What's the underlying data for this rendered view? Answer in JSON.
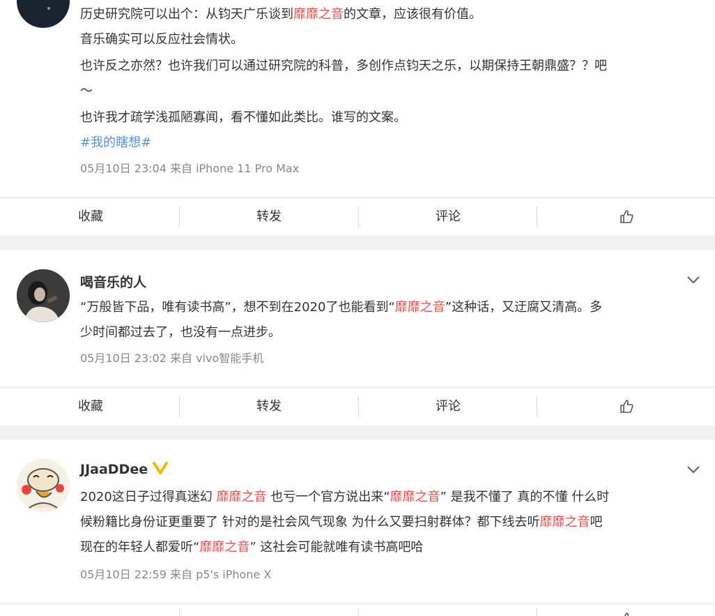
{
  "posts": [
    {
      "lines": [
        [
          "历史研究院可以出个：从钧天广乐谈到",
          "靡靡之音",
          "的文章，应该很有价值。"
        ],
        [
          "音乐确实可以反应社会情状。"
        ],
        [
          "也许反之亦然？也许我们可以通过研究院的科普，多创作点钧天之乐，以期保持王朝鼎盛？？吧"
        ],
        [
          "～"
        ],
        [
          "也许我才疏学浅孤陋寡闻，看不懂如此类比。谁写的文案。"
        ]
      ],
      "tag": "#我的瞎想#",
      "meta": "05月10日 23:04  来自 iPhone 11 Pro Max"
    },
    {
      "name": "喝音乐的人",
      "lines": [
        [
          "“万般皆下品，唯有读书高”，想不到在2020了也能看到“",
          "靡靡之音",
          "”这种话，又迂腐又清高。多"
        ],
        [
          "少时间都过去了，也没有一点进步。"
        ]
      ],
      "meta": "05月10日 23:02  来自 vivo智能手机"
    },
    {
      "name": "JJaaDDee",
      "lines": [
        [
          "2020这日子过得真迷幻 ",
          "靡靡之音",
          " 也亏一个官方说出来“",
          "靡靡之音",
          "” 是我不懂了 真的不懂 什么时"
        ],
        [
          "候粉籍比身份证更重要了 针对的是社会风气现象 为什么又要扫射群体？都下线去听",
          "靡靡之音",
          "吧"
        ],
        [
          "现在的年轻人都爱听“",
          "靡靡之音",
          "” 这社会可能就唯有读书高吧哈"
        ]
      ],
      "meta": "05月10日 22:59  来自 p5's iPhone X"
    }
  ],
  "actions": {
    "collect": "收藏",
    "forward": "转发",
    "comment": "评论"
  },
  "colors": {
    "highlight": "#e05252",
    "topic": "#5a8fd5",
    "verified": "#f5b800"
  }
}
